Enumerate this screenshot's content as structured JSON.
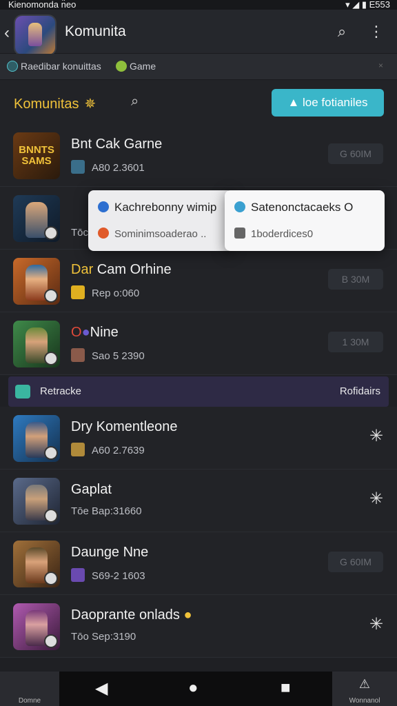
{
  "status": {
    "left": "Kienomonda n̈eo",
    "right": "E553"
  },
  "appbar": {
    "title": "Komunita"
  },
  "filters": {
    "chip1": "Raedibar konuittas",
    "chip2": "Game"
  },
  "section": {
    "title": "Komunitas",
    "primary_button": "loe fotianiles"
  },
  "rows1": [
    {
      "name": "Bnt Cak Garne",
      "name_prefix": "",
      "meta": "A80 2.3601",
      "right": "G 60IM",
      "thumb_label": "BNNTS SAMS"
    },
    {
      "name": "",
      "name_prefix": "",
      "meta": "Tōc",
      "right": "",
      "thumb_label": ""
    },
    {
      "name": " Cam Orhine",
      "name_prefix": "Dar",
      "meta": "Rep o:060",
      "right": "B 30M",
      "thumb_label": ""
    },
    {
      "name": "Nine",
      "name_prefix": "O",
      "meta": "Sao 5 2390",
      "right": "1 30M",
      "thumb_label": ""
    }
  ],
  "popup": {
    "left_line1": "Kachrebonny wimip",
    "left_line2": "Sominimsoaderao",
    "left_more": "..",
    "right_line1": "Satenonctacaeks O",
    "right_line2": "1boderdices0"
  },
  "banner": {
    "label": "Retracke",
    "right": "Rofidairs"
  },
  "rows2": [
    {
      "name": "Dry Komentleone",
      "meta": "A60 2.7639",
      "right_type": "star"
    },
    {
      "name": "Gaplat",
      "meta": "Tōe  Bap:31660",
      "right_type": "star"
    },
    {
      "name": "Daunge Nne",
      "meta": "S69-2 1603",
      "right_type": "pill",
      "right": "G 60IM"
    },
    {
      "name": "Daoprante onlads",
      "meta": "Tōo  Sep:3190",
      "right_type": "star"
    }
  ],
  "nav": {
    "left_label": "Domne",
    "right_label": "Wonnanol"
  },
  "colors": {
    "accent": "#f0c23a",
    "primary_button": "#3ab6c9",
    "background": "#222327"
  }
}
